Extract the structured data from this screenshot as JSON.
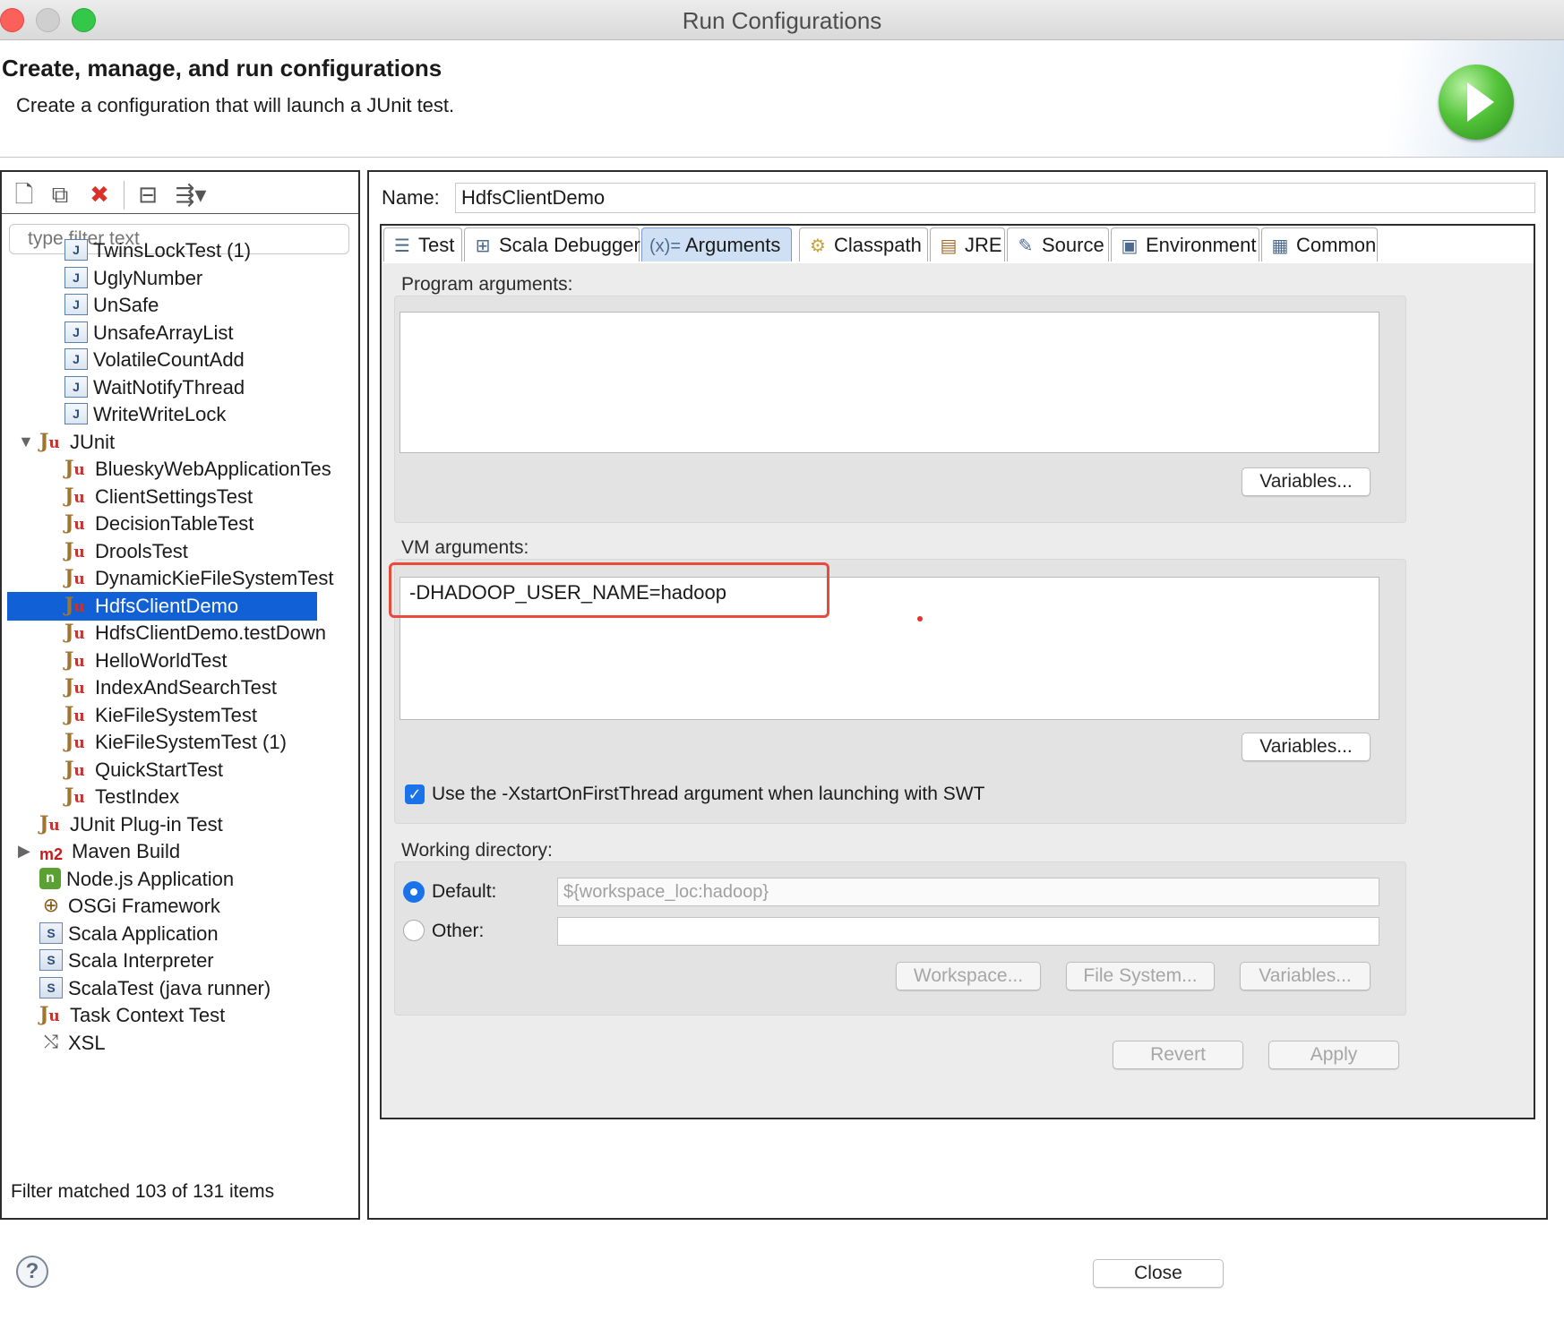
{
  "window": {
    "title": "Run Configurations"
  },
  "banner": {
    "title": "Create, manage, and run configurations",
    "subtitle": "Create a configuration that will launch a JUnit test."
  },
  "left": {
    "filter_placeholder": "type filter text",
    "tree": [
      {
        "label": "TwinsLockTest (1)",
        "icon": "java-class-icon",
        "level": 2
      },
      {
        "label": "UglyNumber",
        "icon": "java-class-icon",
        "level": 2
      },
      {
        "label": "UnSafe",
        "icon": "java-class-icon",
        "level": 2
      },
      {
        "label": "UnsafeArrayList",
        "icon": "java-class-icon",
        "level": 2
      },
      {
        "label": "VolatileCountAdd",
        "icon": "java-class-icon",
        "level": 2
      },
      {
        "label": "WaitNotifyThread",
        "icon": "java-class-icon",
        "level": 2
      },
      {
        "label": "WriteWriteLock",
        "icon": "java-class-icon",
        "level": 2
      },
      {
        "label": "JUnit",
        "icon": "junit-icon",
        "level": 1,
        "expanded": true
      },
      {
        "label": "BlueskyWebApplicationTes",
        "icon": "junit-icon",
        "level": 2
      },
      {
        "label": "ClientSettingsTest",
        "icon": "junit-icon",
        "level": 2
      },
      {
        "label": "DecisionTableTest",
        "icon": "junit-icon",
        "level": 2
      },
      {
        "label": "DroolsTest",
        "icon": "junit-icon",
        "level": 2
      },
      {
        "label": "DynamicKieFileSystemTest",
        "icon": "junit-icon",
        "level": 2
      },
      {
        "label": "HdfsClientDemo",
        "icon": "junit-icon",
        "level": 2,
        "selected": true
      },
      {
        "label": "HdfsClientDemo.testDown",
        "icon": "junit-icon",
        "level": 2
      },
      {
        "label": "HelloWorldTest",
        "icon": "junit-icon",
        "level": 2
      },
      {
        "label": "IndexAndSearchTest",
        "icon": "junit-icon",
        "level": 2
      },
      {
        "label": "KieFileSystemTest",
        "icon": "junit-icon",
        "level": 2
      },
      {
        "label": "KieFileSystemTest (1)",
        "icon": "junit-icon",
        "level": 2
      },
      {
        "label": "QuickStartTest",
        "icon": "junit-icon",
        "level": 2
      },
      {
        "label": "TestIndex",
        "icon": "junit-icon",
        "level": 2
      },
      {
        "label": "JUnit Plug-in Test",
        "icon": "junit-plugin-icon",
        "level": 1
      },
      {
        "label": "Maven Build",
        "icon": "maven-icon",
        "level": 1,
        "collapsed": true
      },
      {
        "label": "Node.js Application",
        "icon": "nodejs-icon",
        "level": 1
      },
      {
        "label": "OSGi Framework",
        "icon": "osgi-icon",
        "level": 1
      },
      {
        "label": "Scala Application",
        "icon": "scala-icon",
        "level": 1
      },
      {
        "label": "Scala Interpreter",
        "icon": "scala-icon",
        "level": 1
      },
      {
        "label": "ScalaTest (java runner)",
        "icon": "scala-icon",
        "level": 1
      },
      {
        "label": "Task Context Test",
        "icon": "junit-icon",
        "level": 1
      },
      {
        "label": "XSL",
        "icon": "xsl-icon",
        "level": 1
      }
    ],
    "status": "Filter matched 103 of 131 items"
  },
  "right": {
    "name_label": "Name:",
    "name_value": "HdfsClientDemo",
    "tabs": [
      {
        "label": "Test",
        "icon": "test-icon"
      },
      {
        "label": "Scala Debugger",
        "icon": "debugger-icon"
      },
      {
        "label": "Arguments",
        "icon": "arguments-icon",
        "active": true
      },
      {
        "label": "Classpath",
        "icon": "classpath-icon"
      },
      {
        "label": "JRE",
        "icon": "jre-icon"
      },
      {
        "label": "Source",
        "icon": "source-icon"
      },
      {
        "label": "Environment",
        "icon": "environment-icon"
      },
      {
        "label": "Common",
        "icon": "common-icon"
      }
    ],
    "program_args_label": "Program arguments:",
    "program_args_value": "",
    "vm_args_label": "VM arguments:",
    "vm_args_value": "-DHADOOP_USER_NAME=hadoop",
    "variables_label": "Variables...",
    "swt_checkbox_label": "Use the -XstartOnFirstThread argument when launching with SWT",
    "working_dir_label": "Working directory:",
    "default_label": "Default:",
    "default_value": "${workspace_loc:hadoop}",
    "other_label": "Other:",
    "other_value": "",
    "workspace_label": "Workspace...",
    "filesystem_label": "File System...",
    "revert_label": "Revert",
    "apply_label": "Apply"
  },
  "footer": {
    "close_label": "Close",
    "help_glyph": "?"
  },
  "colors": {
    "selection": "#1160d6",
    "highlight": "#e84a3c",
    "accent": "#1a73e8"
  }
}
